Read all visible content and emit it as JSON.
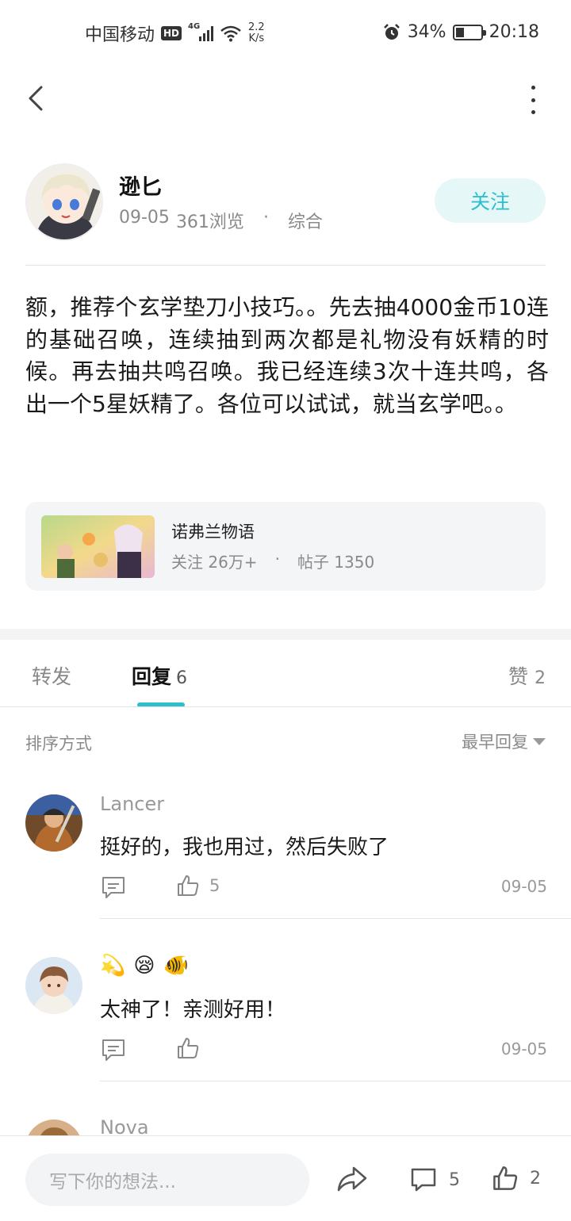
{
  "status_bar": {
    "carrier": "中国移动",
    "hd": "HD",
    "network": "4G",
    "speed_value": "2.2",
    "speed_unit": "K/s",
    "battery_pct": "34%",
    "battery_level": 0.34,
    "time": "20:18"
  },
  "author": {
    "name": "逊匕",
    "date": "09-05",
    "views": "361浏览",
    "separator": "·",
    "category": "综合",
    "follow_label": "关注"
  },
  "post": {
    "body": "额，推荐个玄学垫刀小技巧。。先去抽4000金币10连的基础召唤，连续抽到两次都是礼物没有妖精的时候。再去抽共鸣召唤。我已经连续3次十连共鸣，各出一个5星妖精了。各位可以试试，就当玄学吧。。"
  },
  "forum": {
    "name": "诺弗兰物语",
    "followers": "关注 26万+",
    "separator": "·",
    "posts": "帖子 1350"
  },
  "tabs": {
    "forward": "转发",
    "replies": "回复",
    "replies_count": "6",
    "likes": "赞",
    "likes_count": "2"
  },
  "sort": {
    "label": "排序方式",
    "selected": "最早回复"
  },
  "comments": [
    {
      "name": "Lancer",
      "text": "挺好的，我也用过，然后失败了",
      "likes": "5",
      "date": "09-05"
    },
    {
      "name": "",
      "emojis": [
        "💫",
        "😪",
        "🐠"
      ],
      "text": "太神了！亲测好用！",
      "likes": "",
      "date": "09-05"
    },
    {
      "name": "Nova"
    }
  ],
  "bottom_bar": {
    "placeholder": "写下你的想法...",
    "comment_count": "5",
    "like_count": "2"
  },
  "colors": {
    "accent": "#2cbfcc",
    "follow_bg": "#e6f7f8"
  }
}
